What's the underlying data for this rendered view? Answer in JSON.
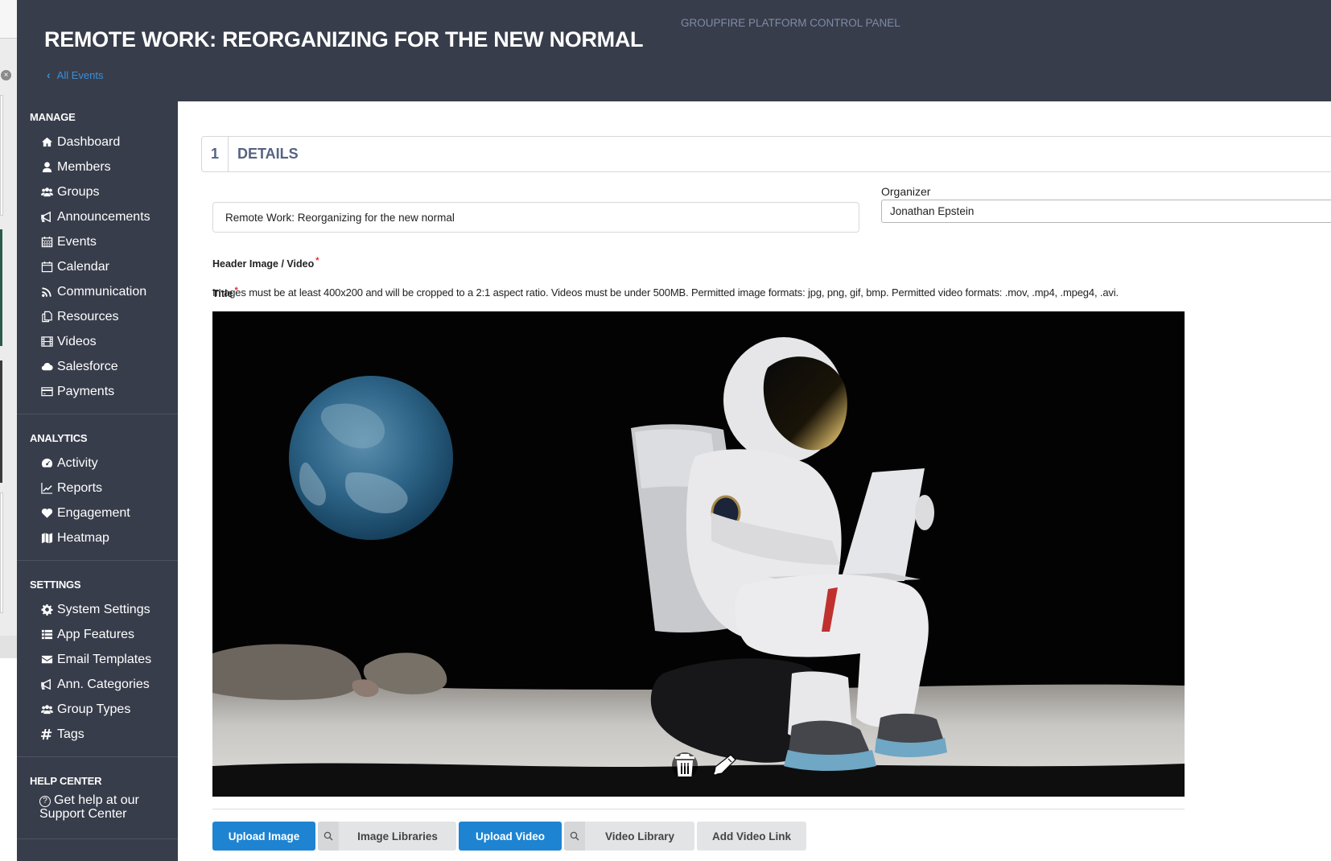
{
  "header": {
    "title": "REMOTE WORK: REORGANIZING FOR THE NEW NORMAL",
    "back_link": "All Events",
    "platform_label": "GROUPFIRE PLATFORM CONTROL PANEL"
  },
  "sidebar": {
    "sections": [
      {
        "title": "MANAGE",
        "items": [
          {
            "label": "Dashboard",
            "icon": "home-icon"
          },
          {
            "label": "Members",
            "icon": "user-icon"
          },
          {
            "label": "Groups",
            "icon": "users-icon"
          },
          {
            "label": "Announcements",
            "icon": "bullhorn-icon"
          },
          {
            "label": "Events",
            "icon": "calendar-grid-icon"
          },
          {
            "label": "Calendar",
            "icon": "calendar-icon"
          },
          {
            "label": "Communication",
            "icon": "rss-icon"
          },
          {
            "label": "Resources",
            "icon": "copy-icon"
          },
          {
            "label": "Videos",
            "icon": "film-icon"
          },
          {
            "label": "Salesforce",
            "icon": "cloud-icon"
          },
          {
            "label": "Payments",
            "icon": "credit-card-icon"
          }
        ]
      },
      {
        "title": "ANALYTICS",
        "items": [
          {
            "label": "Activity",
            "icon": "dashboard-gauge-icon"
          },
          {
            "label": "Reports",
            "icon": "line-chart-icon"
          },
          {
            "label": "Engagement",
            "icon": "heart-icon"
          },
          {
            "label": "Heatmap",
            "icon": "map-icon"
          }
        ]
      },
      {
        "title": "SETTINGS",
        "items": [
          {
            "label": "System Settings",
            "icon": "gear-icon"
          },
          {
            "label": "App Features",
            "icon": "list-icon"
          },
          {
            "label": "Email Templates",
            "icon": "envelope-icon"
          },
          {
            "label": "Ann. Categories",
            "icon": "bullhorn-icon"
          },
          {
            "label": "Group Types",
            "icon": "users-icon"
          },
          {
            "label": "Tags",
            "icon": "hashtag-icon"
          }
        ]
      },
      {
        "title": "HELP CENTER",
        "help_text": "Get help at our Support Center"
      }
    ]
  },
  "main": {
    "section_number": "1",
    "section_title": "DETAILS",
    "title_label": "Title",
    "title_value": "Remote Work: Reorganizing for the new normal",
    "organizer_label": "Organizer",
    "organizer_value": "Jonathan Epstein",
    "header_media_label": "Header Image / Video",
    "required_marker": "*",
    "hint": "Images must be at least 400x200 and will be cropped to a 2:1 aspect ratio. Videos must be under 500MB. Permitted image formats: jpg, png, gif, bmp. Permitted video formats: .mov, .mp4, .mpeg4, .avi.",
    "image_description": "Astronaut sitting on a rock on the moon using a laptop, Earth in the background",
    "buttons": {
      "upload_image": "Upload Image",
      "image_libraries": "Image Libraries",
      "upload_video": "Upload Video",
      "video_library": "Video Library",
      "add_video_link": "Add Video Link"
    },
    "colors": {
      "primary": "#1e84d2",
      "header_bg": "#383d4b",
      "section_title": "#566383",
      "link": "#3a8fd8",
      "required": "#e0312c"
    }
  }
}
